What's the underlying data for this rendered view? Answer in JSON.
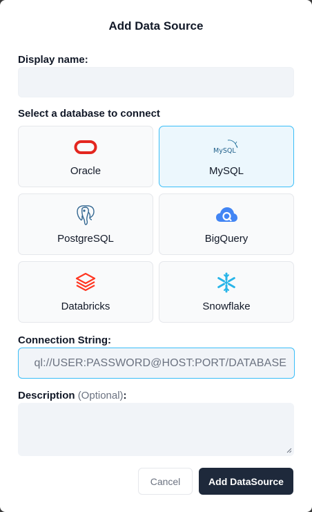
{
  "dialog": {
    "title": "Add Data Source",
    "display_name_label": "Display name:",
    "select_db_label": "Select a database to connect",
    "connection_label": "Connection String:",
    "connection_placeholder": "ql://USER:PASSWORD@HOST:PORT/DATABASE",
    "description_label": "Description",
    "description_optional": "(Optional)",
    "description_colon": ":",
    "cancel_label": "Cancel",
    "add_label": "Add DataSource"
  },
  "databases": [
    {
      "name": "Oracle",
      "icon": "oracle-icon",
      "selected": false
    },
    {
      "name": "MySQL",
      "icon": "mysql-icon",
      "selected": true
    },
    {
      "name": "PostgreSQL",
      "icon": "postgresql-icon",
      "selected": false
    },
    {
      "name": "BigQuery",
      "icon": "bigquery-icon",
      "selected": false
    },
    {
      "name": "Databricks",
      "icon": "databricks-icon",
      "selected": false
    },
    {
      "name": "Snowflake",
      "icon": "snowflake-icon",
      "selected": false
    }
  ],
  "logo_text": {
    "mysql": "MySQL"
  },
  "colors": {
    "accent": "#38bdf8",
    "primary_button": "#1e293b",
    "oracle": "#e3261f",
    "bigquery": "#4285f4",
    "databricks": "#ff3621",
    "snowflake": "#29b5e8"
  }
}
